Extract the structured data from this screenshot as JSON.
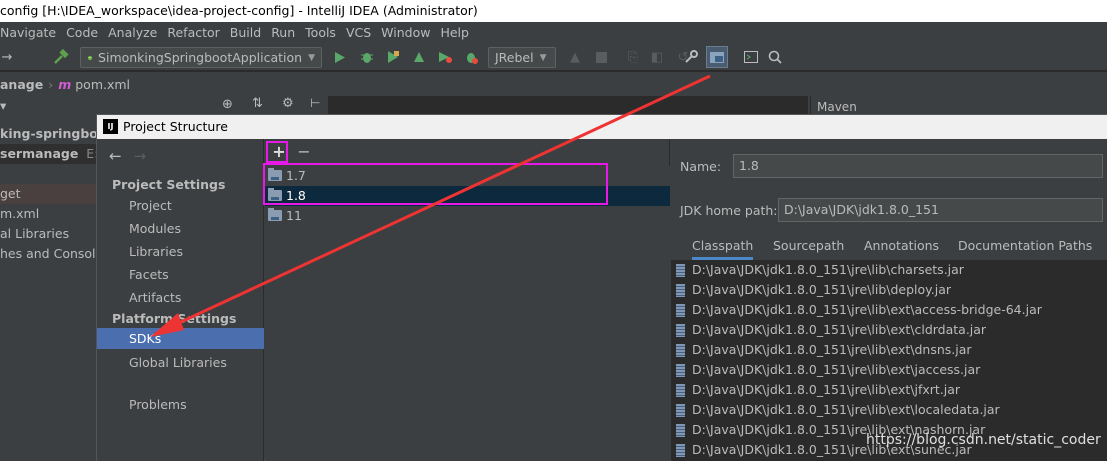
{
  "window": {
    "title": "config [H:\\IDEA_workspace\\idea-project-config] - IntelliJ IDEA (Administrator)"
  },
  "menu": [
    "Navigate",
    "Code",
    "Analyze",
    "Refactor",
    "Build",
    "Run",
    "Tools",
    "VCS",
    "Window",
    "Help"
  ],
  "toolbar": {
    "run_config": "SimonkingSpringbootApplication",
    "jrebel": "JRebel"
  },
  "breadcrumb": {
    "module": "anage",
    "file": "pom.xml",
    "file_icon": "m"
  },
  "bg_project": {
    "rows": [
      "king-springboo",
      "sermanage",
      "E:\\J",
      "get",
      "m.xml",
      "al Libraries",
      "hes and Console"
    ]
  },
  "bg_tool": {
    "maven": "Maven"
  },
  "dialog": {
    "title": "Project Structure",
    "nav": {
      "project_settings_header": "Project Settings",
      "project_items": [
        "Project",
        "Modules",
        "Libraries",
        "Facets",
        "Artifacts"
      ],
      "platform_settings_header": "Platform Settings",
      "platform_items": [
        "SDKs",
        "Global Libraries"
      ],
      "problems": "Problems",
      "selected": "SDKs"
    },
    "sdk_toolbar": {
      "add": "+",
      "remove": "−"
    },
    "sdks": [
      "1.7",
      "1.8",
      "11"
    ],
    "selected_sdk": "1.8",
    "details": {
      "name_label": "Name:",
      "name_value": "1.8",
      "home_label": "JDK home path:",
      "home_value": "D:\\Java\\JDK\\jdk1.8.0_151",
      "tabs": [
        "Classpath",
        "Sourcepath",
        "Annotations",
        "Documentation Paths"
      ],
      "active_tab": "Classpath",
      "classpath": [
        "D:\\Java\\JDK\\jdk1.8.0_151\\jre\\lib\\charsets.jar",
        "D:\\Java\\JDK\\jdk1.8.0_151\\jre\\lib\\deploy.jar",
        "D:\\Java\\JDK\\jdk1.8.0_151\\jre\\lib\\ext\\access-bridge-64.jar",
        "D:\\Java\\JDK\\jdk1.8.0_151\\jre\\lib\\ext\\cldrdata.jar",
        "D:\\Java\\JDK\\jdk1.8.0_151\\jre\\lib\\ext\\dnsns.jar",
        "D:\\Java\\JDK\\jdk1.8.0_151\\jre\\lib\\ext\\jaccess.jar",
        "D:\\Java\\JDK\\jdk1.8.0_151\\jre\\lib\\ext\\jfxrt.jar",
        "D:\\Java\\JDK\\jdk1.8.0_151\\jre\\lib\\ext\\localedata.jar",
        "D:\\Java\\JDK\\jdk1.8.0_151\\jre\\lib\\ext\\nashorn.jar",
        "D:\\Java\\JDK\\jdk1.8.0_151\\jre\\lib\\ext\\sunec.jar"
      ]
    }
  },
  "annotation": {
    "color": "#e619e6",
    "arrow_color": "#ee3333"
  },
  "watermark": "https://blog.csdn.net/static_coder"
}
